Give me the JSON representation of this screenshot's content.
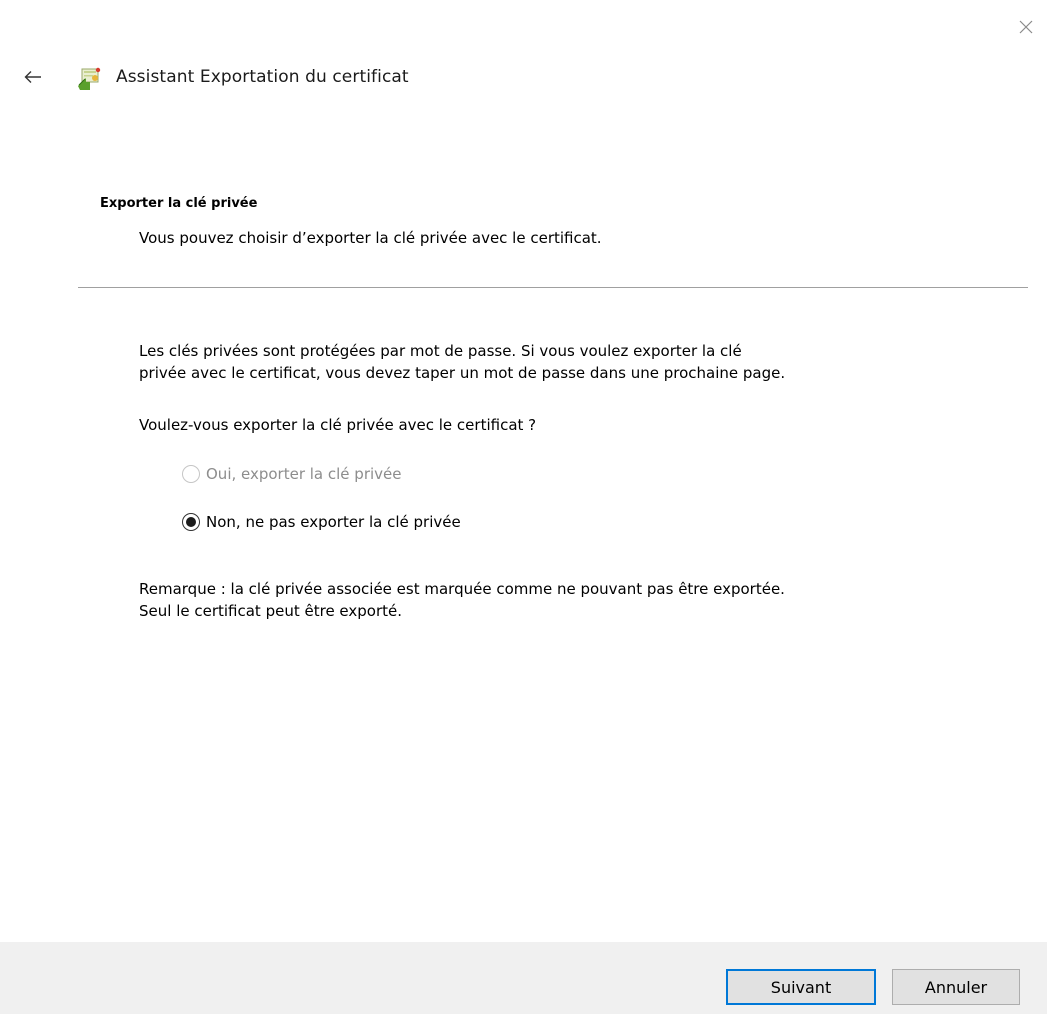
{
  "window": {
    "close_icon": "close-icon"
  },
  "header": {
    "back_icon": "arrow-left-icon",
    "wizard_icon": "certificate-wizard-icon",
    "title": "Assistant Exportation du certificat"
  },
  "section": {
    "heading": "Exporter la clé privée",
    "description": "Vous pouvez choisir d’exporter la clé privée avec le certificat."
  },
  "body": {
    "info": "Les clés privées sont protégées par mot de passe. Si vous voulez exporter la clé\nprivée avec le certificat, vous devez taper un mot de passe dans une prochaine page.",
    "question": "Voulez-vous exporter la clé privée avec le certificat ?",
    "options": [
      {
        "label": "Oui, exporter la clé privée",
        "selected": false,
        "enabled": false
      },
      {
        "label": "Non, ne pas exporter la clé privée",
        "selected": true,
        "enabled": true
      }
    ],
    "note": "Remarque : la clé privée associée est marquée comme ne pouvant pas être exportée.\nSeul le certificat peut être exporté."
  },
  "footer": {
    "next_label": "Suivant",
    "cancel_label": "Annuler"
  },
  "colors": {
    "accent": "#0078d7",
    "footer_bg": "#f0f0f0",
    "disabled_text": "#8d8d8d"
  }
}
